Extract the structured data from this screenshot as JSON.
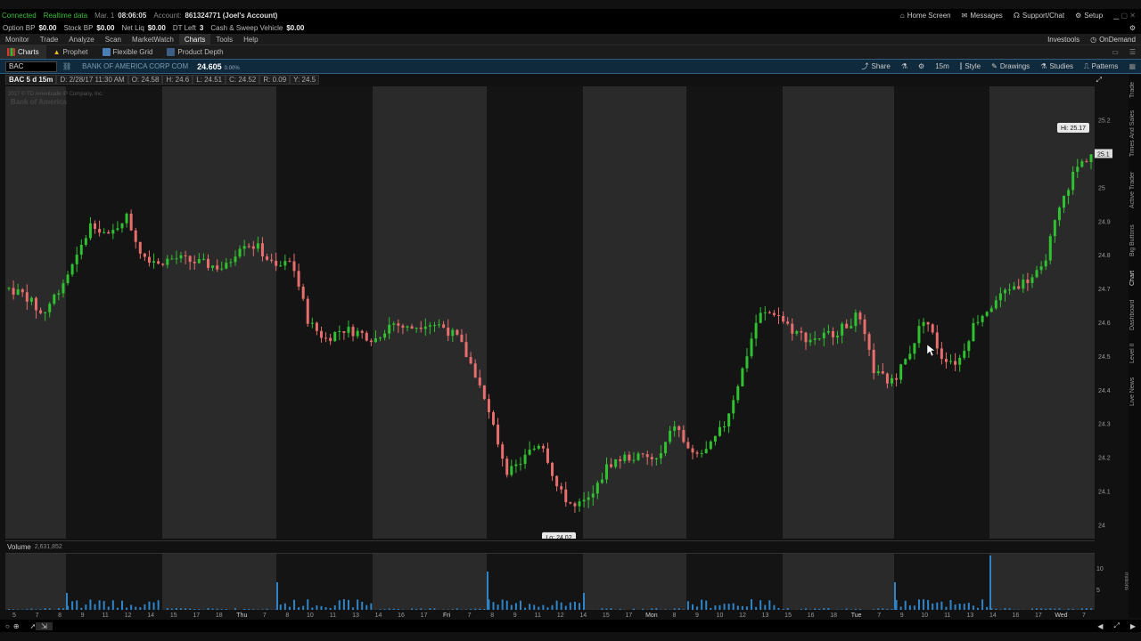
{
  "status": {
    "connection": "Connected",
    "data_feed": "Realtime data",
    "date": "Mar. 1",
    "time": "08:06:05",
    "account_label": "Account:",
    "account_value": "861324771 (Joel's Account)",
    "links": [
      "Home Screen",
      "Messages",
      "Support/Chat",
      "Setup"
    ]
  },
  "buying_power": [
    {
      "label": "Option BP",
      "value": "$0.00"
    },
    {
      "label": "Stock BP",
      "value": "$0.00"
    },
    {
      "label": "Net Liq",
      "value": "$0.00"
    },
    {
      "label": "DT Left",
      "value": "3"
    },
    {
      "label": "Cash & Sweep Vehicle",
      "value": "$0.00"
    }
  ],
  "menu": {
    "items": [
      "Monitor",
      "Trade",
      "Analyze",
      "Scan",
      "MarketWatch",
      "Charts",
      "Tools",
      "Help"
    ],
    "active": "Charts",
    "right": [
      "Investools",
      "OnDemand"
    ]
  },
  "subtabs": {
    "items": [
      "Charts",
      "Prophet",
      "Flexible Grid",
      "Product Depth"
    ],
    "active": "Charts"
  },
  "chart_toolbar": {
    "symbol": "BAC",
    "company": "BANK OF AMERICA CORP COM",
    "last_price": "24.605",
    "change": "0.00%",
    "tools": [
      "Share",
      "15m",
      "Style",
      "Drawings",
      "Studies",
      "Patterns"
    ]
  },
  "ohlc": {
    "label": "BAC 5 d 15m",
    "date": "D: 2/28/17 11:30 AM",
    "open": "O: 24.58",
    "high": "H: 24.6",
    "low": "L: 24.51",
    "close": "C: 24.52",
    "range": "R: 0.09",
    "y": "Y: 24.5"
  },
  "watermark": {
    "copyright": "2017 © TD Ameritrade IP Company, Inc.",
    "brand": "Bank of America"
  },
  "chart_annotations": {
    "high": "Hi: 25.17",
    "low": "Lo: 24.02",
    "last_tag": "25.1"
  },
  "volume": {
    "label": "Volume",
    "value": "2,631,852",
    "axis_unit": "millions",
    "axis_ticks": [
      "10",
      "5"
    ]
  },
  "side_tabs": [
    "Trade",
    "Times And Sales",
    "Active Trader",
    "Big Buttons",
    "Chart",
    "Dashboard",
    "Level II",
    "Live News"
  ],
  "colors": {
    "up": "#2fc12f",
    "down": "#e86d6d",
    "volume": "#2f84c8",
    "session_dark": "#141414",
    "session_light": "#2a2a2a",
    "toolbar": "#0f2a3d"
  },
  "chart_data": {
    "type": "candlestick",
    "interval": "15m",
    "period": "5 d",
    "ylim": [
      23.98,
      25.22
    ],
    "yticks": [
      24.0,
      24.1,
      24.2,
      24.3,
      24.4,
      24.5,
      24.6,
      24.7,
      24.8,
      24.9,
      25.0,
      25.1,
      25.2
    ],
    "high": 25.17,
    "low": 24.02,
    "last": 25.1,
    "session_labels": [
      "Thu",
      "Fri",
      "Mon",
      "Tue",
      "Wed"
    ],
    "time_labels": [
      "5",
      "7",
      "8",
      "9",
      "11",
      "12",
      "14",
      "15",
      "17",
      "18",
      "Thu",
      "7",
      "8",
      "10",
      "11",
      "13",
      "14",
      "16",
      "17",
      "Fri",
      "7",
      "8",
      "9",
      "11",
      "12",
      "14",
      "15",
      "17",
      "Mon",
      "8",
      "9",
      "10",
      "12",
      "13",
      "15",
      "16",
      "18",
      "Tue",
      "7",
      "9",
      "10",
      "11",
      "13",
      "14",
      "16",
      "17",
      "Wed",
      "7"
    ],
    "close_path": [
      24.7,
      24.68,
      24.62,
      24.7,
      24.78,
      24.9,
      24.85,
      24.92,
      24.8,
      24.78,
      24.79,
      24.78,
      24.77,
      24.76,
      24.84,
      24.82,
      24.76,
      24.78,
      24.6,
      24.55,
      24.58,
      24.57,
      24.55,
      24.6,
      24.58,
      24.6,
      24.59,
      24.55,
      24.45,
      24.3,
      24.15,
      24.2,
      24.25,
      24.1,
      24.05,
      24.08,
      24.18,
      24.2,
      24.2,
      24.19,
      24.3,
      24.2,
      24.22,
      24.3,
      24.45,
      24.62,
      24.63,
      24.58,
      24.55,
      24.56,
      24.58,
      24.62,
      24.45,
      24.42,
      24.5,
      24.62,
      24.5,
      24.48,
      24.6,
      24.65,
      24.7,
      24.72,
      24.75,
      24.92,
      25.05,
      25.1
    ],
    "volume_peaks_millions": [
      8.5,
      9.0,
      7.5,
      12.0
    ]
  }
}
